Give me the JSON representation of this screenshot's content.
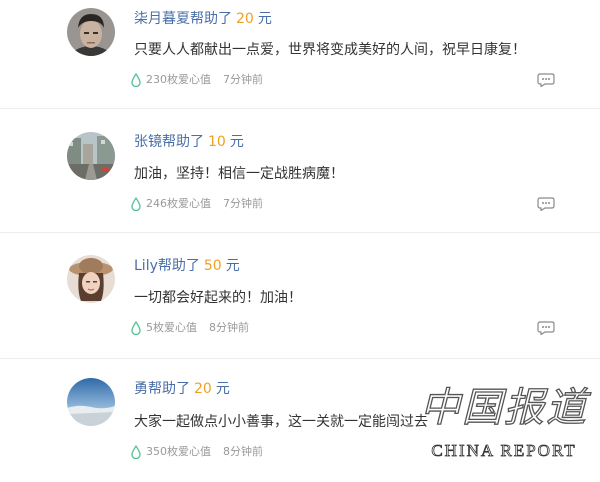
{
  "comments": [
    {
      "user": "柒月暮夏",
      "helped_text": "帮助了",
      "amount": "20",
      "unit": "元",
      "content": "只要人人都献出一点爱，世界将变成美好的人间，祝早日康复！",
      "love_value": "230枚爱心值",
      "time": "7分钟前",
      "avatar_icon": "person-portrait-icon"
    },
    {
      "user": "张镜",
      "helped_text": "帮助了",
      "amount": "10",
      "unit": "元",
      "content": "加油，坚持！相信一定战胜病魔！",
      "love_value": "246枚爱心值",
      "time": "7分钟前",
      "avatar_icon": "city-street-icon"
    },
    {
      "user": "Lily",
      "helped_text": "帮助了",
      "amount": "50",
      "unit": "元",
      "content": "一切都会好起来的！加油！",
      "love_value": "5枚爱心值",
      "time": "8分钟前",
      "avatar_icon": "woman-hat-portrait-icon"
    },
    {
      "user": "勇",
      "helped_text": "帮助了",
      "amount": "20",
      "unit": "元",
      "content": "大家一起做点小小善事，这一关就一定能闯过去",
      "love_value": "350枚爱心值",
      "time": "8分钟前",
      "avatar_icon": "sky-landscape-icon"
    }
  ],
  "colors": {
    "name": "#4a6ea8",
    "amount": "#f0a020",
    "meta": "#999999",
    "drop": "#5cc49a"
  },
  "watermark": {
    "chinese": "中国报道",
    "english": "CHINA REPORT"
  }
}
